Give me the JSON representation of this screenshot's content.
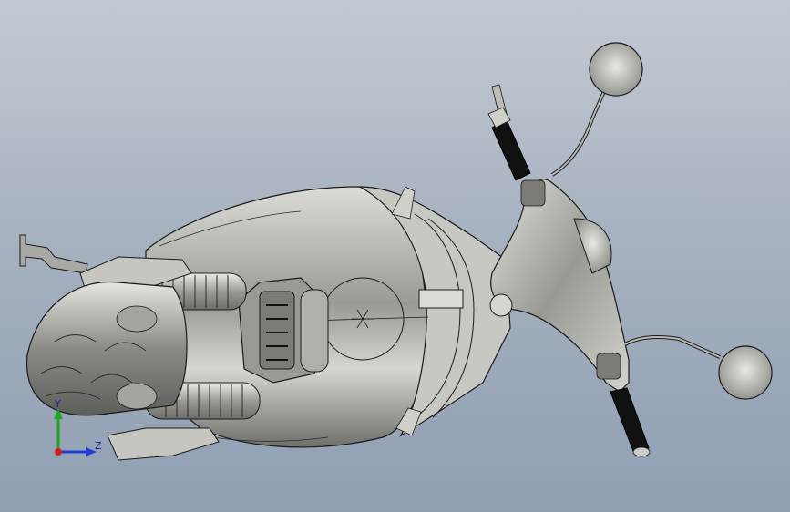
{
  "viewport": {
    "background_top": "#c4cad2",
    "background_bottom": "#8f9fb2"
  },
  "model": {
    "metal_color": "#b9b9b3",
    "edge_color": "#1a1a1a",
    "grip_color": "#0d0d0d"
  },
  "triad": {
    "y_label": "Y",
    "z_label": "Z",
    "y_color": "#1fa51f",
    "z_color": "#1f3fd0",
    "origin_color": "#d01f1f"
  }
}
